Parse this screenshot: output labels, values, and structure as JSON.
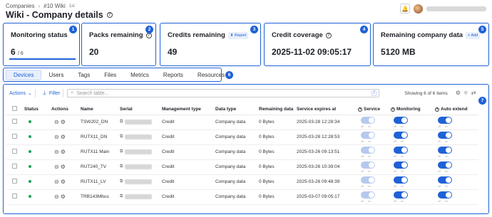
{
  "breadcrumbs": [
    "Companies",
    "#10 Wiki"
  ],
  "breadcrumb_tag": "1st",
  "page_title": "Wiki - Company details",
  "stats": [
    {
      "label": "Monitoring status",
      "value": "6",
      "sub": "/ 6",
      "badge": "1"
    },
    {
      "label": "Packs remaining",
      "value": "20",
      "badge": "2"
    },
    {
      "label": "Credits remaining",
      "value": "49",
      "action": "Report",
      "badge": "3"
    },
    {
      "label": "Credit coverage",
      "value": "2025-11-02 09:05:17",
      "badge": "4"
    },
    {
      "label": "Remaining company data",
      "value": "5120 MB",
      "action": "+ Add",
      "badge": "5"
    }
  ],
  "tabs": {
    "items": [
      "Devices",
      "Users",
      "Tags",
      "Files",
      "Metrics",
      "Reports",
      "Resources"
    ],
    "active": "Devices",
    "badge": "6"
  },
  "toolbar": {
    "actions_label": "Actions",
    "filter_label": "Filter",
    "search_placeholder": "Search table...",
    "search_shortcut": "/",
    "showing": "Showing 6 of 6 items",
    "badge": "7"
  },
  "table": {
    "columns": [
      "Status",
      "Actions",
      "Name",
      "Serial",
      "Management type",
      "Data type",
      "Remaining data",
      "Service expires at",
      "Service",
      "Monitoring",
      "Auto extend"
    ],
    "toggle_labels": {
      "off": "off",
      "on": "on"
    },
    "rows": [
      {
        "name": "TSW202_DN",
        "management": "Credit",
        "data_type": "Company data",
        "remaining": "0 Bytes",
        "expires": "2025-03-28 12:28:34"
      },
      {
        "name": "RUTX11_DN",
        "management": "Credit",
        "data_type": "Company data",
        "remaining": "0 Bytes",
        "expires": "2025-03-28 12:28:53"
      },
      {
        "name": "RUTX11 Main",
        "management": "Credit",
        "data_type": "Company data",
        "remaining": "0 Bytes",
        "expires": "2025-03-26 09:13:51"
      },
      {
        "name": "RUT240_TV",
        "management": "Credit",
        "data_type": "Company data",
        "remaining": "0 Bytes",
        "expires": "2025-03-26 10:39:04"
      },
      {
        "name": "RUTX11_LV",
        "management": "Credit",
        "data_type": "Company data",
        "remaining": "0 Bytes",
        "expires": "2025-03-26 09:48:39"
      },
      {
        "name": "TRB143Mbus",
        "management": "Credit",
        "data_type": "Company data",
        "remaining": "0 Bytes",
        "expires": "2025-03-07 09:05:17"
      }
    ]
  },
  "colors": {
    "accent": "#1f62d6",
    "status_online": "#19a35b"
  },
  "icons": [
    "help-icon",
    "bell-icon",
    "chevron-down-icon",
    "filter-icon",
    "search-icon",
    "settings-icon",
    "location-icon",
    "refresh-icon",
    "copy-icon",
    "report-icon"
  ]
}
